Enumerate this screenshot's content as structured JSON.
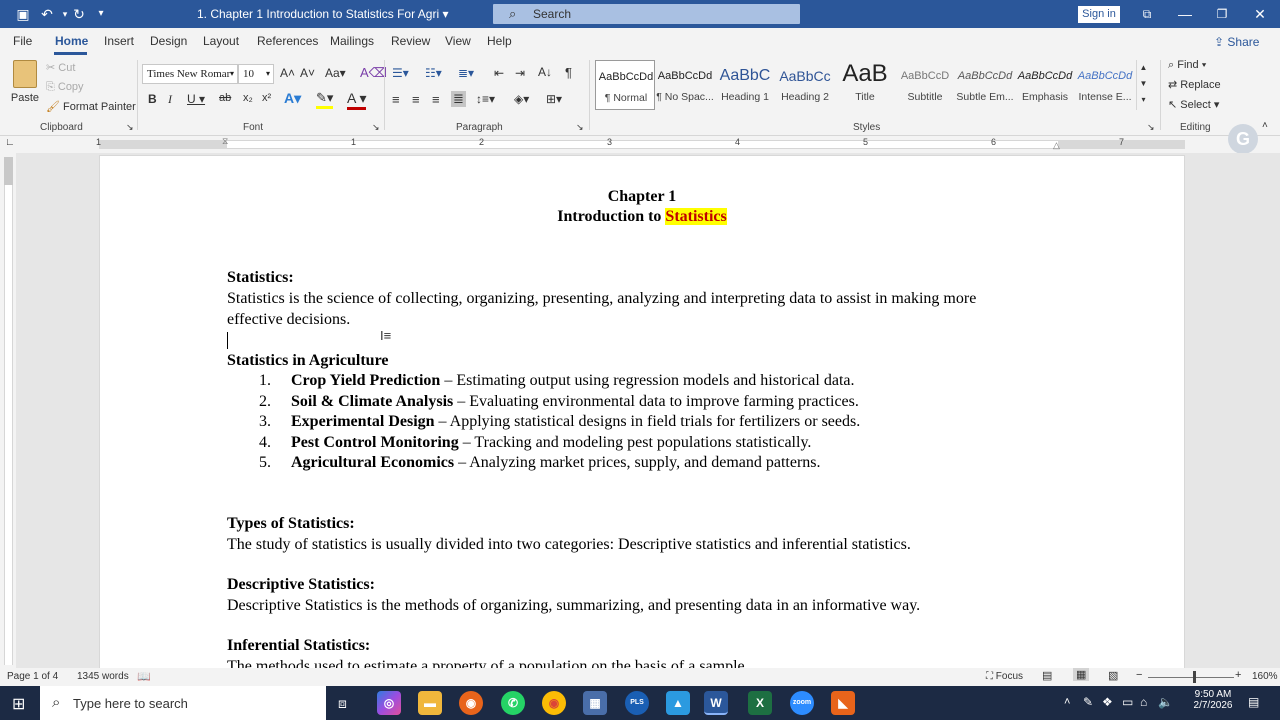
{
  "titlebar": {
    "doc_title": "1. Chapter 1 Introduction to Statistics For Agri",
    "search_placeholder": "Search",
    "signin": "Sign in"
  },
  "menus": [
    "File",
    "Home",
    "Insert",
    "Design",
    "Layout",
    "References",
    "Mailings",
    "Review",
    "View",
    "Help"
  ],
  "share": "Share",
  "clipboard": {
    "paste": "Paste",
    "cut": "Cut",
    "copy": "Copy",
    "format_painter": "Format Painter",
    "label": "Clipboard"
  },
  "font": {
    "name": "Times New Romar",
    "size": "10",
    "label": "Font"
  },
  "paragraph": {
    "label": "Paragraph"
  },
  "styles": {
    "label": "Styles",
    "items": [
      {
        "preview": "AaBbCcDd",
        "name": "¶ Normal"
      },
      {
        "preview": "AaBbCcDd",
        "name": "¶ No Spac..."
      },
      {
        "preview": "AaBbC",
        "name": "Heading 1"
      },
      {
        "preview": "AaBbCc",
        "name": "Heading 2"
      },
      {
        "preview": "AaB",
        "name": "Title"
      },
      {
        "preview": "AaBbCcD",
        "name": "Subtitle"
      },
      {
        "preview": "AaBbCcDd",
        "name": "Subtle Em..."
      },
      {
        "preview": "AaBbCcDd",
        "name": "Emphasis"
      },
      {
        "preview": "AaBbCcDd",
        "name": "Intense E..."
      }
    ]
  },
  "editing": {
    "find": "Find",
    "replace": "Replace",
    "select": "Select",
    "label": "Editing"
  },
  "ruler_numbers": [
    "1",
    "1",
    "2",
    "3",
    "4",
    "5",
    "6",
    "7"
  ],
  "document": {
    "chapter": "Chapter 1",
    "intro_prefix": "Introduction to ",
    "intro_highlight": "Statistics",
    "h_statistics": "Statistics:",
    "p_statistics_1": "Statistics is the science of collecting, organizing, presenting, analyzing and interpreting data to assist in making more",
    "p_statistics_2": "effective decisions.",
    "h_agri": "Statistics in Agriculture",
    "list": [
      {
        "num": "1.",
        "bold": "Crop Yield Prediction",
        "rest": " – Estimating output using regression models and historical data."
      },
      {
        "num": "2.",
        "bold": "Soil & Climate Analysis",
        "rest": " – Evaluating environmental data to improve farming practices."
      },
      {
        "num": "3.",
        "bold": "Experimental Design",
        "rest": " – Applying statistical designs in field trials for fertilizers or seeds."
      },
      {
        "num": "4.",
        "bold": "Pest Control Monitoring",
        "rest": " – Tracking and modeling pest populations statistically."
      },
      {
        "num": "5.",
        "bold": "Agricultural Economics",
        "rest": " – Analyzing market prices, supply, and demand patterns."
      }
    ],
    "h_types": "Types of Statistics:",
    "p_types": "The study of statistics is usually divided into two categories: Descriptive statistics and inferential statistics.",
    "h_desc": "Descriptive Statistics:",
    "p_desc": "Descriptive Statistics is the methods of organizing, summarizing, and presenting data in an informative way.",
    "h_inf": "Inferential Statistics:",
    "p_inf": "The methods used to estimate a property of a population on the basis of a sample."
  },
  "status": {
    "page": "Page 1 of 4",
    "words": "1345 words",
    "focus": "Focus",
    "zoom": "160%"
  },
  "taskbar": {
    "search_placeholder": "Type here to search",
    "time": "9:50 AM",
    "date": "2/7/2026"
  }
}
